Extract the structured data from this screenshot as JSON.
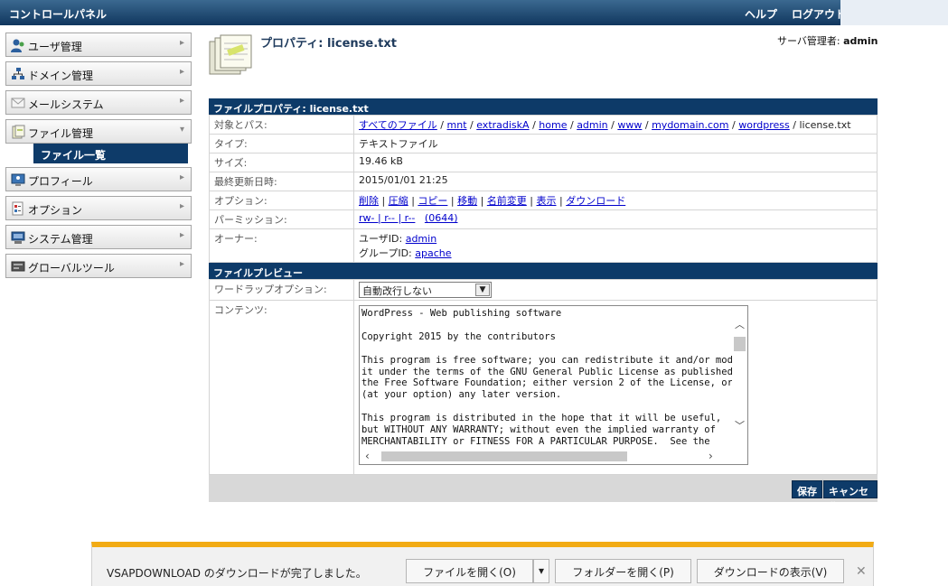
{
  "header": {
    "title": "コントロールパネル",
    "help": "ヘルプ",
    "logout": "ログアウト"
  },
  "sidebar": {
    "items": [
      {
        "label": "ユーザ管理",
        "icon": "users-icon"
      },
      {
        "label": "ドメイン管理",
        "icon": "domain-icon"
      },
      {
        "label": "メールシステム",
        "icon": "mail-icon"
      },
      {
        "label": "ファイル管理",
        "icon": "file-manager-icon"
      },
      {
        "label": "プロフィール",
        "icon": "profile-icon"
      },
      {
        "label": "オプション",
        "icon": "options-icon"
      },
      {
        "label": "システム管理",
        "icon": "system-icon"
      },
      {
        "label": "グローバルツール",
        "icon": "global-tools-icon"
      }
    ],
    "sub_item": "ファイル一覧"
  },
  "page": {
    "title": "プロパティ: license.txt",
    "admin_label": "サーバ管理者:",
    "admin_name": "admin"
  },
  "props": {
    "section_title": "ファイルプロパティ: license.txt",
    "path_label": "対象とパス:",
    "path_parts": [
      "すべてのファイル",
      "mnt",
      "extradiskA",
      "home",
      "admin",
      "www",
      "mydomain.com",
      "wordpress"
    ],
    "path_file": "license.txt",
    "type_label": "タイプ:",
    "type_value": "テキストファイル",
    "size_label": "サイズ:",
    "size_value": "19.46 kB",
    "modified_label": "最終更新日時:",
    "modified_value": "2015/01/01 21:25",
    "options_label": "オプション:",
    "options": [
      "削除",
      "圧縮",
      "コピー",
      "移動",
      "名前変更",
      "表示",
      "ダウンロード"
    ],
    "perm_label": "パーミッション:",
    "perm_value": "rw- | r-- | r--",
    "perm_octal": "(0644)",
    "owner_label": "オーナー:",
    "user_id_label": "ユーザID:",
    "user_id": "admin",
    "group_id_label": "グループID:",
    "group_id": "apache"
  },
  "preview": {
    "section_title": "ファイルプレビュー",
    "wrap_label": "ワードラップオプション:",
    "wrap_value": "自動改行しない",
    "content_label": "コンテンツ:",
    "content": "WordPress - Web publishing software\n\nCopyright 2015 by the contributors\n\nThis program is free software; you can redistribute it and/or modify\nit under the terms of the GNU General Public License as published by\nthe Free Software Foundation; either version 2 of the License, or\n(at your option) any later version.\n\nThis program is distributed in the hope that it will be useful,\nbut WITHOUT ANY WARRANTY; without even the implied warranty of\nMERCHANTABILITY or FITNESS FOR A PARTICULAR PURPOSE.  See the"
  },
  "buttons": {
    "save": "保存",
    "cancel": "キャンセル"
  },
  "download": {
    "message": "VSAPDOWNLOAD のダウンロードが完了しました。",
    "open_file": "ファイルを開く(O)",
    "open_folder": "フォルダーを開く(P)",
    "show_downloads": "ダウンロードの表示(V)"
  },
  "colors": {
    "nav_dark": "#0e3b69",
    "download_accent": "#f2ab14"
  }
}
